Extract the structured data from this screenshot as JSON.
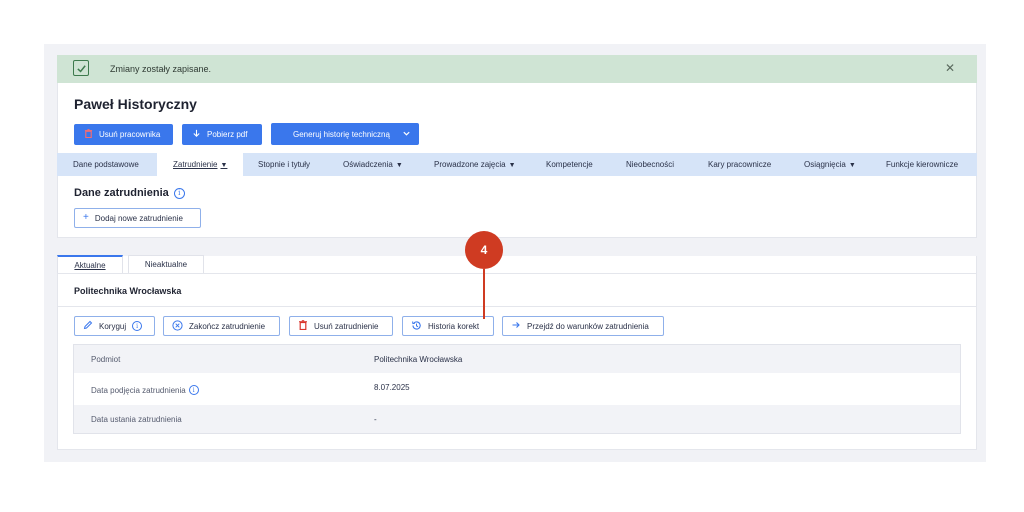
{
  "alert": {
    "message": "Zmiany zostały zapisane.",
    "close_glyph": "✕"
  },
  "page": {
    "title": "Paweł Historyczny"
  },
  "actions": {
    "delete_employee": "Usuń pracownika",
    "download_pdf": "Pobierz pdf",
    "generate_history": "Generuj historię techniczną"
  },
  "nav": {
    "items": [
      {
        "label": "Dane podstawowe",
        "has_dropdown": false
      },
      {
        "label": "Zatrudnienie",
        "has_dropdown": true,
        "active": true
      },
      {
        "label": "Stopnie i tytuły",
        "has_dropdown": false
      },
      {
        "label": "Oświadczenia",
        "has_dropdown": true
      },
      {
        "label": "Prowadzone zajęcia",
        "has_dropdown": true
      },
      {
        "label": "Kompetencje",
        "has_dropdown": false
      },
      {
        "label": "Nieobecności",
        "has_dropdown": false
      },
      {
        "label": "Kary pracownicze",
        "has_dropdown": false
      },
      {
        "label": "Osiągnięcia",
        "has_dropdown": true
      },
      {
        "label": "Funkcje kierownicze",
        "has_dropdown": false
      }
    ]
  },
  "employment": {
    "section_title": "Dane zatrudnienia",
    "add_button": "Dodaj nowe zatrudnienie",
    "subtabs": {
      "current": "Aktualne",
      "inactive": "Nieaktualne"
    }
  },
  "card": {
    "title": "Politechnika Wrocławska",
    "buttons": {
      "correct": "Koryguj",
      "finish": "Zakończ zatrudnienie",
      "delete": "Usuń zatrudnienie",
      "history": "Historia korekt",
      "goto_conditions": "Przejdź do warunków zatrudnienia"
    },
    "rows": [
      {
        "key": "Podmiot",
        "value": "Politechnika Wrocławska"
      },
      {
        "key": "Data podjęcia zatrudnienia",
        "value": "8.07.2025"
      },
      {
        "key": "Data ustania zatrudnienia",
        "value": "-"
      }
    ]
  },
  "annotation": {
    "step": "4"
  },
  "colors": {
    "primary": "#3a77ec",
    "success_bg": "#cfe4d4",
    "nav_bg": "#d6e4f8",
    "annotation": "#cf3b22",
    "danger": "#d9342b"
  }
}
